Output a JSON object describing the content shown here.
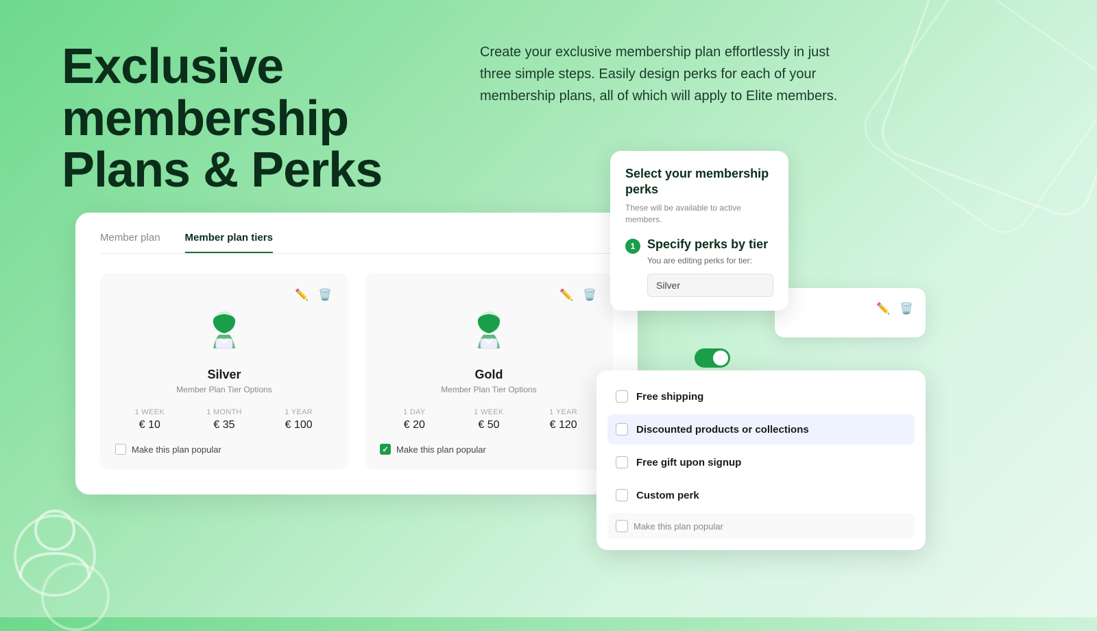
{
  "hero": {
    "title": "Exclusive membership Plans & Perks",
    "description": "Create your exclusive membership plan effortlessly in just three simple steps. Easily design perks for each of your membership plans, all of which will apply to Elite members."
  },
  "tabs": {
    "items": [
      {
        "label": "Member plan",
        "active": false
      },
      {
        "label": "Member plan tiers",
        "active": true
      }
    ]
  },
  "tiers": [
    {
      "name": "Silver",
      "subtitle": "Member Plan Tier Options",
      "pricing": [
        {
          "period": "1 WEEK",
          "price": "€ 10"
        },
        {
          "period": "1 MONTH",
          "price": "€ 35"
        },
        {
          "period": "1 YEAR",
          "price": "€ 100"
        }
      ],
      "popular_label": "Make this plan popular",
      "popular_checked": false
    },
    {
      "name": "Gold",
      "subtitle": "Member Plan Tier Options",
      "pricing": [
        {
          "period": "1 DAY",
          "price": "€ 20"
        },
        {
          "period": "1 WEEK",
          "price": "€ 50"
        },
        {
          "period": "1 YEAR",
          "price": "€ 120"
        }
      ],
      "popular_label": "Make this plan popular",
      "popular_checked": true
    }
  ],
  "perks_select_card": {
    "title": "Select your membership perks",
    "subtitle": "These will be available to active members.",
    "step_number": "1",
    "step_title": "Specify perks by tier",
    "step_desc": "You are editing perks for tier:",
    "tier_value": "Silver"
  },
  "perks_options": {
    "items": [
      {
        "label": "Free shipping",
        "checked": false,
        "highlighted": false
      },
      {
        "label": "Discounted products or collections",
        "checked": false,
        "highlighted": true
      },
      {
        "label": "Free gift upon signup",
        "checked": false,
        "highlighted": false
      },
      {
        "label": "Custom perk",
        "checked": false,
        "highlighted": false
      }
    ],
    "popular_label": "Make this plan popular"
  }
}
